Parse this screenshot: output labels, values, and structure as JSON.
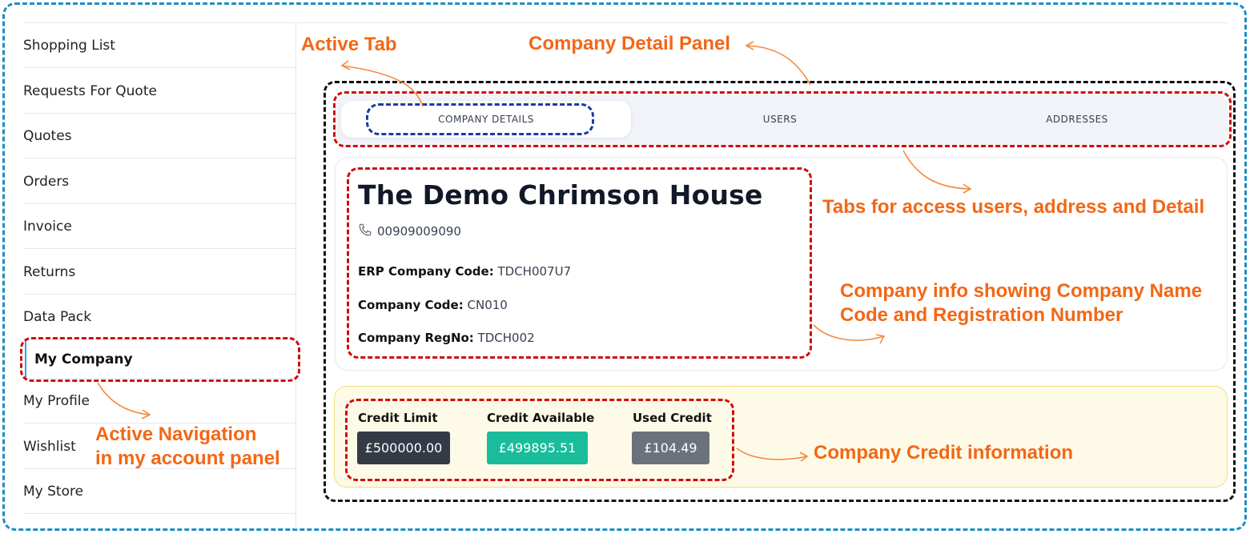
{
  "sidebar": {
    "items": [
      {
        "label": "Shopping List",
        "active": false
      },
      {
        "label": "Requests For Quote",
        "active": false
      },
      {
        "label": "Quotes",
        "active": false
      },
      {
        "label": "Orders",
        "active": false
      },
      {
        "label": "Invoice",
        "active": false
      },
      {
        "label": "Returns",
        "active": false
      },
      {
        "label": "Data Pack",
        "active": false
      },
      {
        "label": "My Company",
        "active": true
      },
      {
        "label": "My Profile",
        "active": false
      },
      {
        "label": "Wishlist",
        "active": false
      },
      {
        "label": "My Store",
        "active": false
      }
    ]
  },
  "tabs": [
    {
      "label": "COMPANY DETAILS",
      "active": true
    },
    {
      "label": "USERS",
      "active": false
    },
    {
      "label": "ADDRESSES",
      "active": false
    }
  ],
  "company": {
    "name": "The Demo Chrimson House",
    "phone_icon": "phone-icon",
    "phone": "00909009090",
    "fields": [
      {
        "label": "ERP Company Code:",
        "value": "TDCH007U7"
      },
      {
        "label": "Company Code:",
        "value": "CN010"
      },
      {
        "label": "Company RegNo:",
        "value": "TDCH002"
      }
    ]
  },
  "credit": [
    {
      "label": "Credit Limit",
      "value": "£500000.00",
      "color": "#343a46"
    },
    {
      "label": "Credit Available",
      "value": "£499895.51",
      "color": "#1abc9c"
    },
    {
      "label": "Used Credit",
      "value": "£104.49",
      "color": "#6c727c"
    }
  ],
  "annotations": {
    "active_tab": "Active Tab",
    "company_detail_panel": "Company Detail Panel",
    "tabs_note": "Tabs for access users, address and Detail",
    "company_info_line1": "Company info showing Company Name",
    "company_info_line2": "Code and Registration Number",
    "active_nav_line1": "Active Navigation",
    "active_nav_line2": "in my account panel",
    "credit_info": "Company Credit information"
  },
  "colors": {
    "annotation": "#f26716",
    "frame": "#1b8fc4",
    "highlight_red": "#d10b0b",
    "active_tab_outline": "#1a3aa6",
    "active_nav_bar": "#2ea3e0"
  }
}
